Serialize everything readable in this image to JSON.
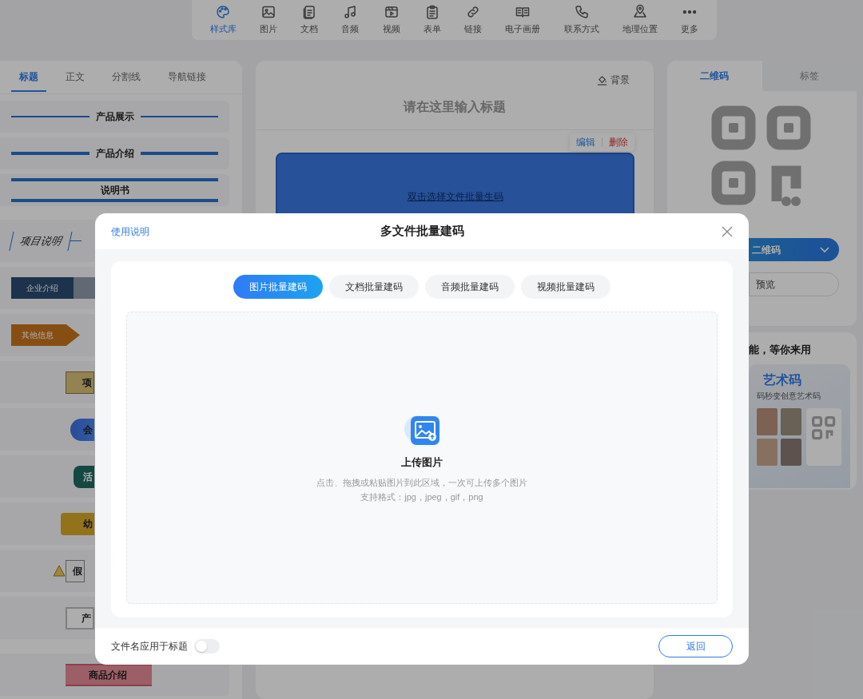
{
  "toolbar": {
    "items": [
      {
        "label": "样式库",
        "selected": true
      },
      {
        "label": "图片",
        "selected": false
      },
      {
        "label": "文档",
        "selected": false
      },
      {
        "label": "音频",
        "selected": false
      },
      {
        "label": "视频",
        "selected": false
      },
      {
        "label": "表单",
        "selected": false
      },
      {
        "label": "链接",
        "selected": false
      },
      {
        "label": "电子画册",
        "selected": false
      },
      {
        "label": "联系方式",
        "selected": false
      },
      {
        "label": "地理位置",
        "selected": false
      },
      {
        "label": "更多",
        "selected": false
      }
    ]
  },
  "left_panel": {
    "tabs": [
      {
        "label": "标题",
        "selected": true
      },
      {
        "label": "正文",
        "selected": false
      },
      {
        "label": "分割线",
        "selected": false
      },
      {
        "label": "导航链接",
        "selected": false
      }
    ],
    "styles": [
      {
        "kind": "line-thin",
        "label": "产品展示"
      },
      {
        "kind": "line-thick",
        "label": "产品介绍"
      },
      {
        "kind": "double-line",
        "label": "说明书"
      },
      {
        "kind": "slanted",
        "label": "项目说明"
      },
      {
        "kind": "tab-dark",
        "label": "企业介绍"
      },
      {
        "kind": "arrow-tag",
        "label": "其他信息"
      },
      {
        "kind": "ribbon",
        "label": "项"
      },
      {
        "kind": "pill",
        "label": "会"
      },
      {
        "kind": "scroll",
        "label": "活"
      },
      {
        "kind": "banner",
        "label": "幼"
      },
      {
        "kind": "warning",
        "label": "假"
      },
      {
        "kind": "frame",
        "label": "产"
      },
      {
        "kind": "ribbon-pink",
        "label": "商品介绍"
      }
    ]
  },
  "editor": {
    "background_button": "背景",
    "title_placeholder": "请在这里输入标题",
    "block_actions": [
      {
        "kind": "edit",
        "label": "编辑"
      },
      {
        "kind": "delete",
        "label": "删除"
      }
    ],
    "block_hint": "双击选择文件批量生码"
  },
  "right_panel": {
    "tabs": [
      {
        "label": "二维码",
        "selected": true
      },
      {
        "label": "标签",
        "selected": false
      }
    ],
    "generate_button": "二维码",
    "preview_button": "预览",
    "promo": {
      "title": "能，等你来用",
      "card_title": "艺术码",
      "card_subtitle": "码秒变创意艺术码"
    }
  },
  "modal": {
    "help_link": "使用说明",
    "title": "多文件批量建码",
    "tabs": [
      {
        "label": "图片批量建码",
        "selected": true
      },
      {
        "label": "文档批量建码",
        "selected": false
      },
      {
        "label": "音频批量建码",
        "selected": false
      },
      {
        "label": "视频批量建码",
        "selected": false
      }
    ],
    "upload": {
      "title": "上传图片",
      "hint": "点击、拖拽或粘贴图片到此区域，一次可上传多个图片",
      "formats": "支持格式：jpg，jpeg，gif，png"
    },
    "filename_toggle": {
      "label": "文件名应用于标题",
      "on": false
    },
    "back_button": "返回"
  }
}
